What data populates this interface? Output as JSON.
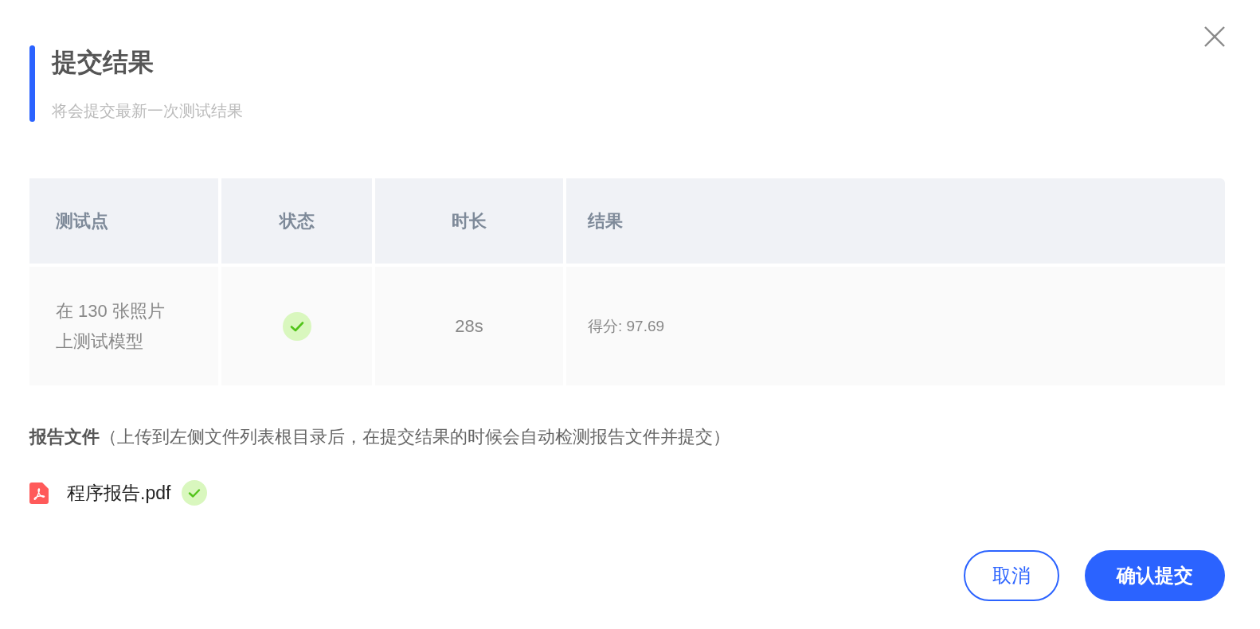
{
  "dialog": {
    "title": "提交结果",
    "subtitle": "将会提交最新一次测试结果"
  },
  "table": {
    "columns": [
      "测试点",
      "状态",
      "时长",
      "结果"
    ],
    "rows": [
      {
        "test_point": "在 130 张照片上测试模型",
        "passed": true,
        "duration": "28s",
        "result": "得分: 97.69"
      }
    ]
  },
  "report": {
    "text": "**报告文件**（上传到左侧文件列表根目录后，在提交结果的时候会自动检测报告文件并提交）"
  },
  "files": [
    {
      "name": "程序报告.pdf",
      "uploaded": true
    }
  ],
  "buttons": [
    {
      "label": "取消",
      "kind": "secondary"
    },
    {
      "label": "确认提交",
      "kind": "primary"
    }
  ]
}
